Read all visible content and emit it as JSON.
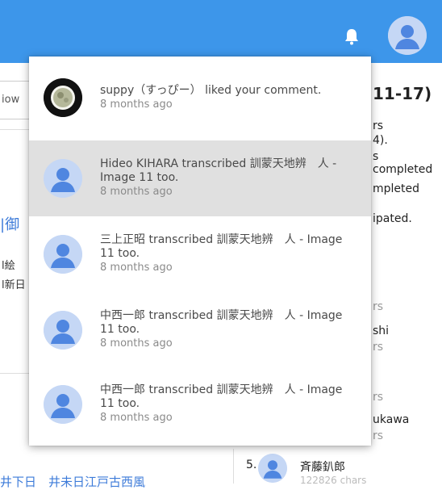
{
  "app": {
    "bar_color": "#3d96ea"
  },
  "topbar": {
    "bell_icon": "bell-icon",
    "avatar_icon": "user-avatar-icon"
  },
  "background": {
    "input_partial": "iow",
    "left_link": "|御",
    "left_small": [
      "l絵",
      "l新日"
    ],
    "right_title": "11-17)",
    "right_lines": [
      "rs",
      "4).",
      "s completed",
      "mpleted",
      "ipated."
    ],
    "right_ranks": [
      "rs",
      "shi",
      "rs",
      "rs",
      "ukawa",
      "rs"
    ],
    "rank5_number": "5.",
    "rank5_name": "斉藤釟郎",
    "rank5_sub": "122826 chars",
    "bottom_link": "井下日　井未日江戸古西風"
  },
  "notifications": [
    {
      "message": "suppy（すっぴー） liked your comment.",
      "time": "8 months ago",
      "avatar": "photo",
      "selected": false
    },
    {
      "message": "Hideo KIHARA transcribed 訓蒙天地辨　人 - Image 11 too.",
      "time": "8 months ago",
      "avatar": "default",
      "selected": true
    },
    {
      "message": "三上正昭 transcribed 訓蒙天地辨　人 - Image 11 too.",
      "time": "8 months ago",
      "avatar": "default",
      "selected": false
    },
    {
      "message": "中西一郎 transcribed 訓蒙天地辨　人 - Image 11 too.",
      "time": "8 months ago",
      "avatar": "default",
      "selected": false
    },
    {
      "message": "中西一郎 transcribed 訓蒙天地辨　人 - Image 11 too.",
      "time": "8 months ago",
      "avatar": "default",
      "selected": false
    }
  ]
}
